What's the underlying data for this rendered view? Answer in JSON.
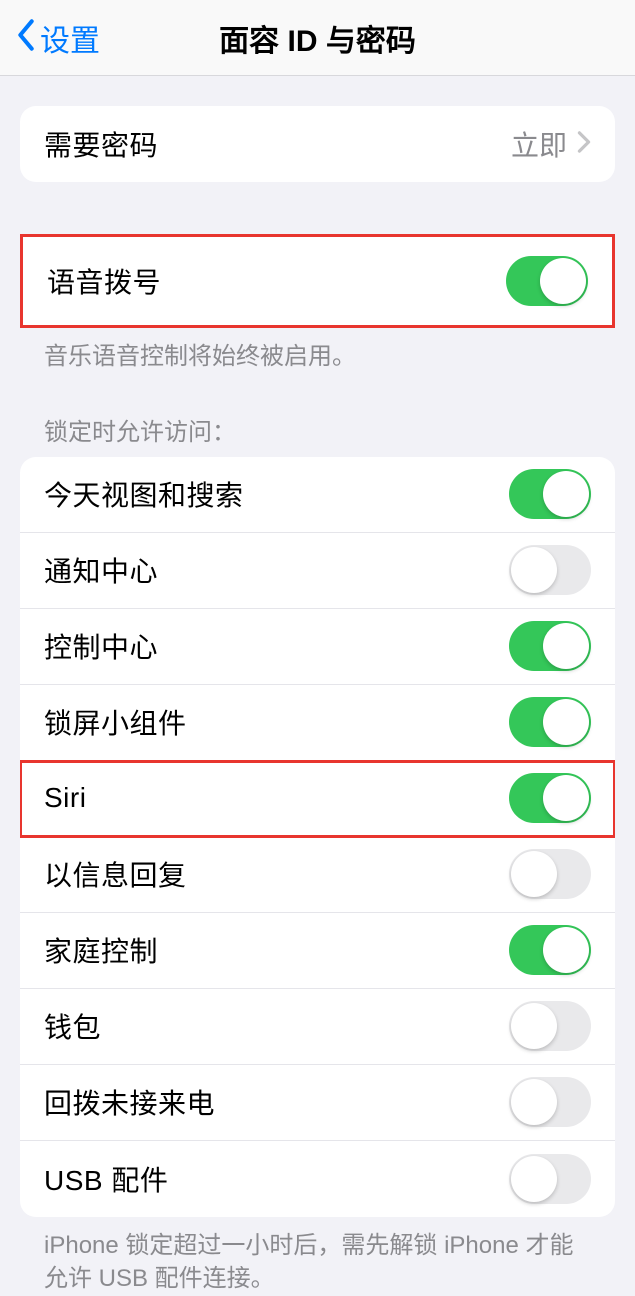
{
  "navbar": {
    "back_label": "设置",
    "title": "面容 ID 与密码"
  },
  "require_passcode": {
    "label": "需要密码",
    "value": "立即"
  },
  "voice_dial": {
    "label": "语音拨号",
    "on": true,
    "footer": "音乐语音控制将始终被启用。"
  },
  "allow_access_header": "锁定时允许访问：",
  "allow_access_items": [
    {
      "label": "今天视图和搜索",
      "on": true
    },
    {
      "label": "通知中心",
      "on": false
    },
    {
      "label": "控制中心",
      "on": true
    },
    {
      "label": "锁屏小组件",
      "on": true
    },
    {
      "label": "Siri",
      "on": true,
      "highlighted": true
    },
    {
      "label": "以信息回复",
      "on": false
    },
    {
      "label": "家庭控制",
      "on": true
    },
    {
      "label": "钱包",
      "on": false
    },
    {
      "label": "回拨未接来电",
      "on": false
    },
    {
      "label": "USB 配件",
      "on": false
    }
  ],
  "usb_footer": "iPhone 锁定超过一小时后，需先解锁 iPhone 才能允许 USB 配件连接。"
}
